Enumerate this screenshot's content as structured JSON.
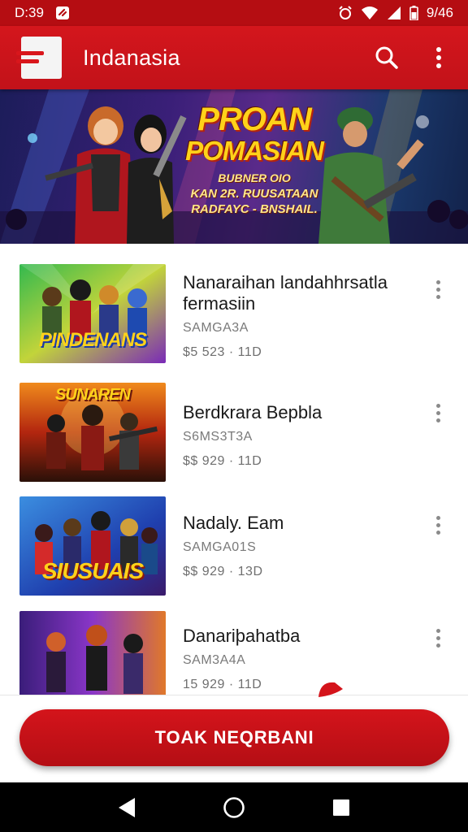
{
  "status_bar": {
    "time": "D:39",
    "battery_text": "9/46",
    "icons": [
      "notification-app-icon",
      "alarm-icon",
      "wifi-icon",
      "signal-icon",
      "battery-icon"
    ]
  },
  "app_bar": {
    "title": "Indanasia",
    "logo": "app-logo",
    "actions": [
      "search-icon",
      "more-vertical-icon"
    ],
    "color": "#c8141b"
  },
  "banner": {
    "headline_1": "PROAN",
    "headline_2": "POMASIAN",
    "sub_1": "BUBNER OIO",
    "sub_2": "KAN 2R. RUUSATAAN",
    "sub_3": "RADFAYC - BNSHAIL."
  },
  "games": [
    {
      "title": "Nanaraihan landahhrsatla fermasiin",
      "publisher": "SAMGA3A",
      "price": "$5 523 · 11D",
      "thumb_caption": "PINDENANS",
      "thumb_palette": [
        "#2aa84a",
        "#c9d22c",
        "#7a2ab8"
      ]
    },
    {
      "title": "Berdkrara Bepbla",
      "publisher": "S6MS3T3A",
      "price": "$$ 929 · 11D",
      "thumb_caption": "SUNAREN",
      "thumb_palette": [
        "#b3260f",
        "#f08a1c",
        "#2a1008"
      ]
    },
    {
      "title": "Nadaly. Eam",
      "publisher": "SAMGA01S",
      "price": "$$ 929 · 13D",
      "thumb_caption": "SIUSUAIS",
      "thumb_palette": [
        "#1f3fae",
        "#3b8ee0",
        "#d42a2a"
      ]
    },
    {
      "title": "Danariþahatba",
      "publisher": "SAM3A4A",
      "price": "15 929 · 11D",
      "thumb_caption": "",
      "thumb_palette": [
        "#3a1d7a",
        "#8a36c8",
        "#e0782a"
      ]
    }
  ],
  "cta": {
    "label": "TOAK NEQRBANI",
    "color": "#c8141b"
  },
  "nav": [
    "back-icon",
    "home-icon",
    "recents-icon"
  ]
}
